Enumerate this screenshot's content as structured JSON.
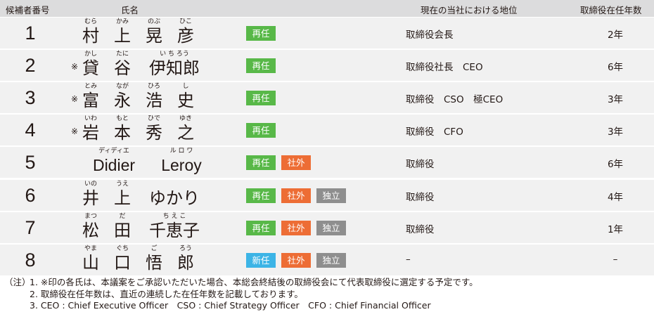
{
  "header": {
    "candidate_number": "候補者番号",
    "name": "氏名",
    "position": "現在の当社における地位",
    "years": "取締役在任年数"
  },
  "colors": {
    "reappointed": "#58b848",
    "outside": "#ed6d35",
    "independent": "#8e8e8e",
    "new": "#3cb4e6",
    "row_background": "#f1f1f1",
    "header_background": "#dcdcdd"
  },
  "candidates": [
    {
      "number": "1",
      "mark": "",
      "name_parts": [
        {
          "kanji": "村",
          "ruby": "むら"
        },
        {
          "kanji": "上",
          "ruby": "かみ"
        },
        {
          "kanji": "晃",
          "ruby": "のぶ"
        },
        {
          "kanji": "彦",
          "ruby": "ひこ"
        }
      ],
      "badges": [
        {
          "label": "再任",
          "type": "reappointed"
        }
      ],
      "position": "取締役会長",
      "years": "2年"
    },
    {
      "number": "2",
      "mark": "※",
      "name_parts": [
        {
          "kanji": "貸",
          "ruby": "かし"
        },
        {
          "kanji": "谷",
          "ruby": "たに"
        },
        {
          "kanji": "伊知郎",
          "ruby": "い ち ろう"
        }
      ],
      "badges": [
        {
          "label": "再任",
          "type": "reappointed"
        }
      ],
      "position": "取締役社長　CEO",
      "years": "6年"
    },
    {
      "number": "3",
      "mark": "※",
      "name_parts": [
        {
          "kanji": "富",
          "ruby": "とみ"
        },
        {
          "kanji": "永",
          "ruby": "なが"
        },
        {
          "kanji": "浩",
          "ruby": "ひろ"
        },
        {
          "kanji": "史",
          "ruby": "し"
        }
      ],
      "badges": [
        {
          "label": "再任",
          "type": "reappointed"
        }
      ],
      "position": "取締役　CSO　極CEO",
      "years": "3年"
    },
    {
      "number": "4",
      "mark": "※",
      "name_parts": [
        {
          "kanji": "岩",
          "ruby": "いわ"
        },
        {
          "kanji": "本",
          "ruby": "もと"
        },
        {
          "kanji": "秀",
          "ruby": "ひで"
        },
        {
          "kanji": "之",
          "ruby": "ゆき"
        }
      ],
      "badges": [
        {
          "label": "再任",
          "type": "reappointed"
        }
      ],
      "position": "取締役　CFO",
      "years": "3年"
    },
    {
      "number": "5",
      "mark": "",
      "name_parts": [
        {
          "kanji": "Didier",
          "ruby": "ディディエ"
        },
        {
          "kanji": "Leroy",
          "ruby": "ル ロ ワ"
        }
      ],
      "badges": [
        {
          "label": "再任",
          "type": "reappointed"
        },
        {
          "label": "社外",
          "type": "outside"
        }
      ],
      "position": "取締役",
      "years": "6年"
    },
    {
      "number": "6",
      "mark": "",
      "name_parts": [
        {
          "kanji": "井",
          "ruby": "いの"
        },
        {
          "kanji": "上",
          "ruby": "うえ"
        },
        {
          "kanji": "ゆかり",
          "ruby": ""
        }
      ],
      "badges": [
        {
          "label": "再任",
          "type": "reappointed"
        },
        {
          "label": "社外",
          "type": "outside"
        },
        {
          "label": "独立",
          "type": "independent"
        }
      ],
      "position": "取締役",
      "years": "4年"
    },
    {
      "number": "7",
      "mark": "",
      "name_parts": [
        {
          "kanji": "松",
          "ruby": "まつ"
        },
        {
          "kanji": "田",
          "ruby": "だ"
        },
        {
          "kanji": "千恵子",
          "ruby": "ち え こ"
        }
      ],
      "badges": [
        {
          "label": "再任",
          "type": "reappointed"
        },
        {
          "label": "社外",
          "type": "outside"
        },
        {
          "label": "独立",
          "type": "independent"
        }
      ],
      "position": "取締役",
      "years": "1年"
    },
    {
      "number": "8",
      "mark": "",
      "name_parts": [
        {
          "kanji": "山",
          "ruby": "やま"
        },
        {
          "kanji": "口",
          "ruby": "ぐち"
        },
        {
          "kanji": "悟",
          "ruby": "ご"
        },
        {
          "kanji": "郎",
          "ruby": "ろう"
        }
      ],
      "badges": [
        {
          "label": "新任",
          "type": "new"
        },
        {
          "label": "社外",
          "type": "outside"
        },
        {
          "label": "独立",
          "type": "independent"
        }
      ],
      "position": "–",
      "years": "–"
    }
  ],
  "notes": {
    "prefix": "（注）",
    "items": [
      "1.  ※印の各氏は、本議案をご承認いただいた場合、本総会終結後の取締役会にて代表取締役に選定する予定です。",
      "2.  取締役在任年数は、直近の連続した在任年数を記載しております。",
      "3.  CEO : Chief Executive Officer　CSO : Chief Strategy Officer　CFO : Chief Financial Officer"
    ]
  }
}
